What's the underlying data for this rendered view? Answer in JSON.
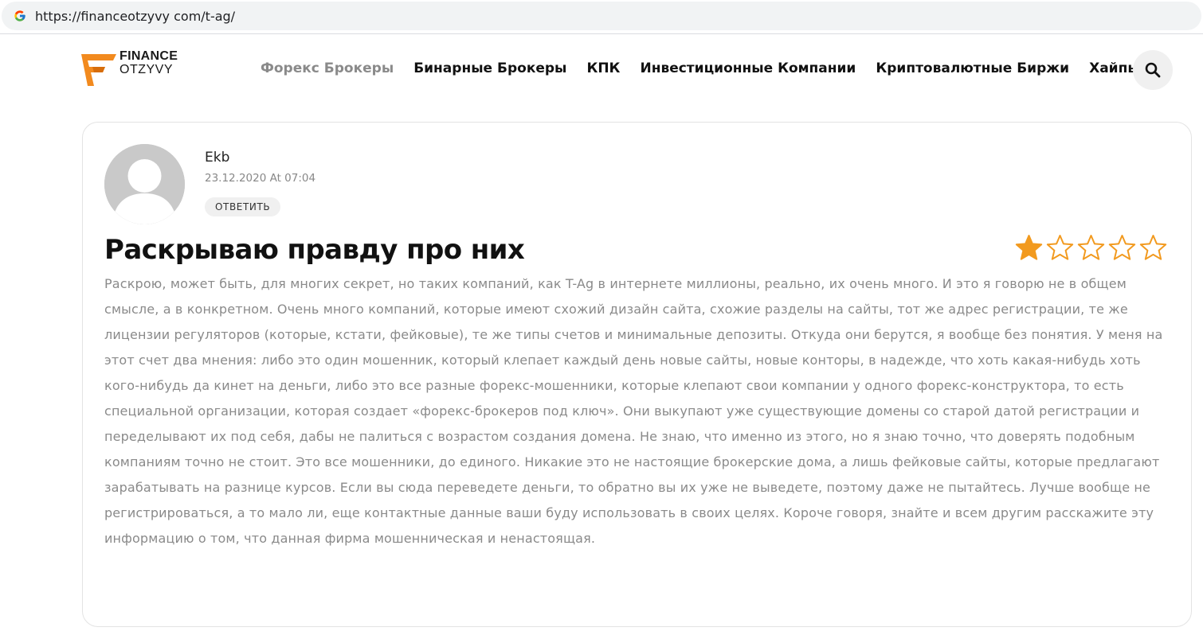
{
  "browser": {
    "url": "https://financeotzyvy com/t-ag/",
    "favicon_icon": "google-g-icon"
  },
  "header": {
    "logo": {
      "line1": "FINANCE",
      "line2": "OTZYVY",
      "accent_color": "#f28a1e"
    },
    "nav": [
      {
        "label": "Форекс Брокеры",
        "active": true
      },
      {
        "label": "Бинарные Брокеры",
        "active": false
      },
      {
        "label": "КПК",
        "active": false
      },
      {
        "label": "Инвестиционные Компании",
        "active": false
      },
      {
        "label": "Криптовалютные Биржи",
        "active": false
      },
      {
        "label": "Хайпы",
        "active": false
      }
    ],
    "search_icon": "search-icon"
  },
  "review": {
    "author": "Ekb",
    "date": "23.12.2020 At 07:04",
    "reply_label": "ОТВЕТИТЬ",
    "title": "Раскрываю правду про них",
    "rating": 1,
    "rating_max": 5,
    "star_color": "#f29a1f",
    "text": "Раскрою, может быть, для многих секрет, но таких компаний, как T-Ag в интернете миллионы, реально, их очень много. И это я говорю не в общем смысле, а в конкретном. Очень много компаний, которые имеют схожий дизайн сайта, схожие разделы на сайты, тот же адрес регистрации, те же лицензии регуляторов (которые, кстати, фейковые), те же типы счетов и минимальные депозиты. Откуда они берутся, я вообще без понятия. У меня на этот счет два мнения: либо это один мошенник, который клепает каждый день новые сайты, новые конторы, в надежде, что хоть какая-нибудь хоть кого-нибудь да кинет на деньги, либо это все разные форекс-мошенники, которые клепают свои компании у одного форекс-конструктора, то есть специальной организации, которая создает «форекс-брокеров под ключ». Они выкупают уже существующие домены со старой датой регистрации и переделывают их под себя, дабы не палиться с возрастом создания домена. Не знаю, что именно из этого, но я знаю точно, что доверять подобным компаниям точно не стоит. Это все мошенники, до единого. Никакие это не настоящие брокерские дома, а лишь фейковые сайты, которые предлагают зарабатывать на разнице курсов. Если вы сюда переведете деньги, то обратно вы их уже не выведете, поэтому даже не пытайтесь. Лучше вообще не регистрироваться, а то мало ли, еще контактные данные ваши буду использовать в своих целях. Короче говоря, знайте и всем другим расскажите эту информацию о том, что данная фирма мошенническая и ненастоящая."
  }
}
